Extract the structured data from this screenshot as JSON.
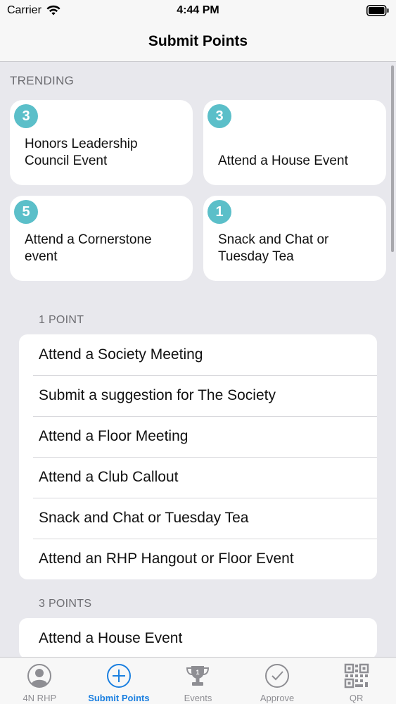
{
  "status_bar": {
    "carrier": "Carrier",
    "time": "4:44 PM"
  },
  "nav": {
    "title": "Submit Points"
  },
  "trending": {
    "header": "TRENDING",
    "cards": [
      {
        "points": "3",
        "title": "Honors Leadership Council Event"
      },
      {
        "points": "3",
        "title": "Attend a House Event"
      },
      {
        "points": "5",
        "title": "Attend a Cornerstone event"
      },
      {
        "points": "1",
        "title": "Snack and Chat or Tuesday Tea"
      }
    ]
  },
  "sections": [
    {
      "header": "1 POINT",
      "items": [
        "Attend a Society Meeting",
        "Submit a suggestion for The Society",
        "Attend a Floor Meeting",
        "Attend a Club Callout",
        "Snack and Chat or Tuesday Tea",
        "Attend an RHP Hangout or Floor Event"
      ]
    },
    {
      "header": "3 POINTS",
      "items": [
        "Attend a House Event"
      ]
    }
  ],
  "tab_bar": {
    "tabs": [
      {
        "label": "4N RHP",
        "icon": "person-icon"
      },
      {
        "label": "Submit Points",
        "icon": "plus-circle-icon",
        "active": true
      },
      {
        "label": "Events",
        "icon": "trophy-icon"
      },
      {
        "label": "Approve",
        "icon": "checkmark-circle-icon"
      },
      {
        "label": "QR",
        "icon": "qr-code-icon"
      }
    ]
  },
  "colors": {
    "badge": "#5bbfc9",
    "active_tab": "#1a7fe0",
    "inactive_tab": "#8e8e93"
  }
}
